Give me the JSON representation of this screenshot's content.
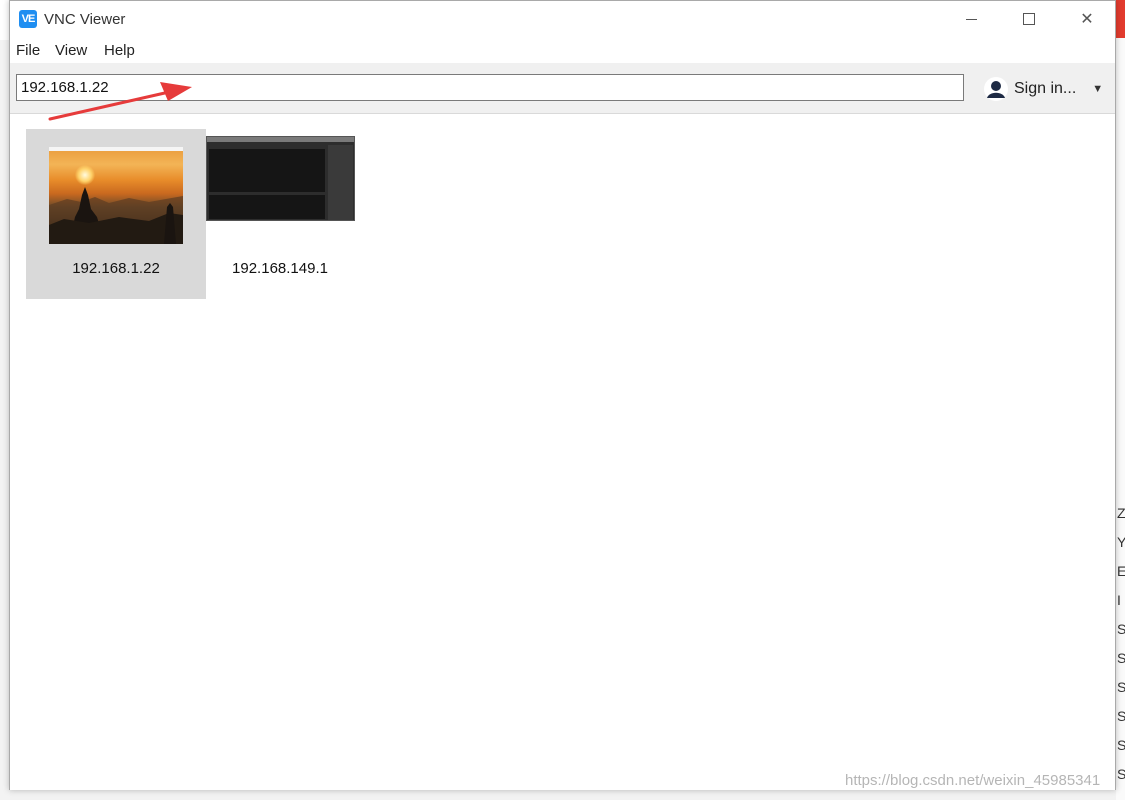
{
  "window": {
    "title": "VNC Viewer",
    "logo_text": "VE",
    "close_glyph": "✕"
  },
  "menu": {
    "items": [
      "File",
      "View",
      "Help"
    ]
  },
  "toolbar": {
    "address_value": "192.168.1.22",
    "signin_label": "Sign in...",
    "signin_dropdown": "▼"
  },
  "connections": [
    {
      "label": "192.168.1.22",
      "selected": true
    },
    {
      "label": "192.168.149.1",
      "selected": false
    }
  ],
  "watermark": "https://blog.csdn.net/weixin_45985341",
  "background_right_glyphs": [
    "Z",
    "Y",
    "E",
    "I",
    "S",
    "S",
    "S",
    "S",
    "S",
    "S"
  ],
  "colors": {
    "accent": "#1f8ef1",
    "selection": "#d9d9d9",
    "annotation_arrow": "#e63b3b"
  },
  "icons": {
    "app": "vnc-logo-icon",
    "account": "user-avatar-icon",
    "dropdown": "caret-down-icon"
  }
}
